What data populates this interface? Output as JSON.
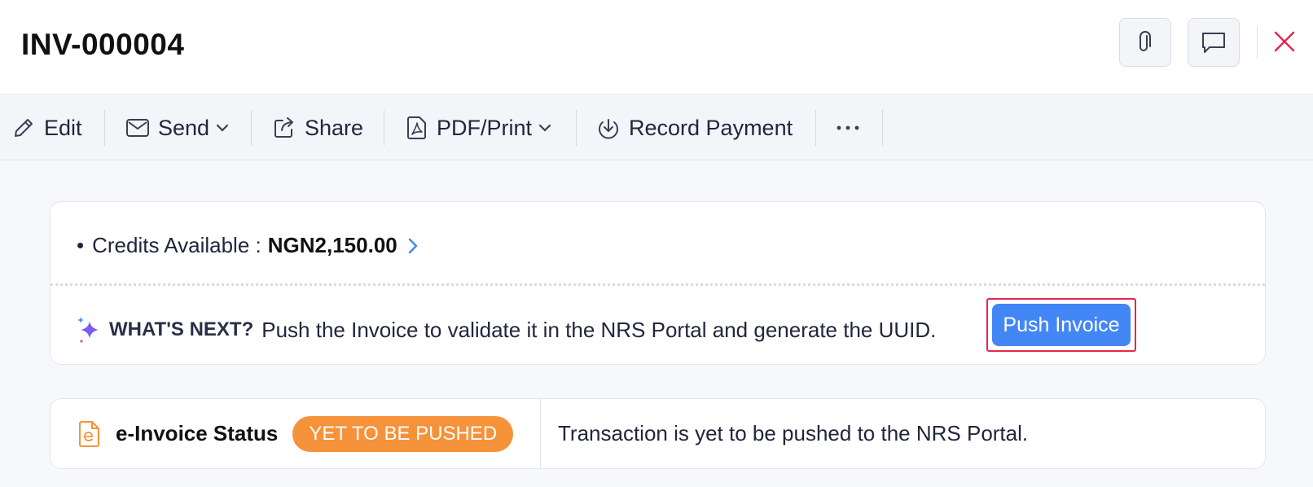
{
  "header": {
    "title": "INV-000004",
    "icons": {
      "attach": "paperclip-icon",
      "comment": "comment-icon",
      "close": "close-icon"
    },
    "close_color": "#e5274d"
  },
  "toolbar": {
    "items": [
      {
        "label": "Edit",
        "icon": "pencil-icon",
        "dropdown": false
      },
      {
        "label": "Send",
        "icon": "envelope-icon",
        "dropdown": true
      },
      {
        "label": "Share",
        "icon": "share-icon",
        "dropdown": false
      },
      {
        "label": "PDF/Print",
        "icon": "pdf-icon",
        "dropdown": true
      },
      {
        "label": "Record Payment",
        "icon": "download-circle-icon",
        "dropdown": false
      },
      {
        "label": "",
        "icon": "more-icon",
        "dropdown": false
      }
    ]
  },
  "credits": {
    "label": "Credits Available :",
    "amount": "NGN2,150.00"
  },
  "whats_next": {
    "heading": "WHAT'S NEXT?",
    "message": "Push the Invoice to validate it in the NRS Portal and generate the UUID.",
    "button_label": "Push Invoice",
    "button_color": "#4287f5",
    "highlight_color": "#e5274d"
  },
  "einvoice": {
    "title": "e-Invoice Status",
    "badge": "YET TO BE PUSHED",
    "badge_color": "#f6923a",
    "message": "Transaction is yet to be pushed to the NRS Portal."
  }
}
